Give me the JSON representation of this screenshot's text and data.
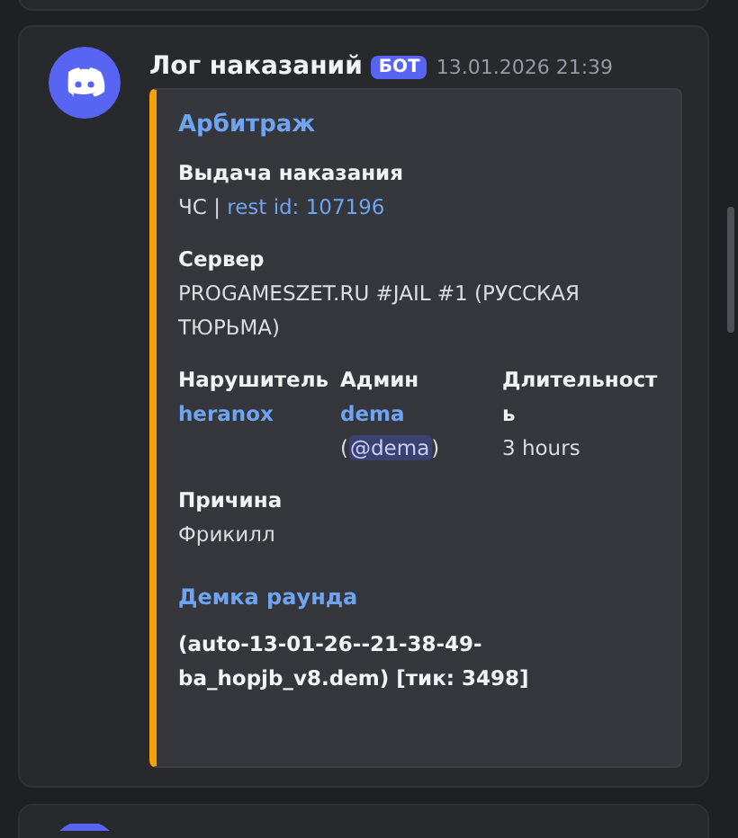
{
  "author": {
    "name": "Лог наказаний",
    "badge": "БОТ",
    "timestamp": "13.01.2026 21:39"
  },
  "embed": {
    "title": "Арбитраж",
    "fields": [
      {
        "name": "Выдача наказания",
        "inline": false,
        "lines": [
          [
            {
              "text": "ЧС | ",
              "kind": "plain"
            },
            {
              "text": "rest id: 107196",
              "kind": "link"
            }
          ]
        ]
      },
      {
        "name": "Сервер",
        "inline": false,
        "lines": [
          [
            {
              "text": "PROGAMESZET.RU #JAIL #1 (РУССКАЯ ТЮРЬМА)",
              "kind": "plain"
            }
          ]
        ]
      },
      {
        "name": "Нарушитель",
        "inline": true,
        "lines": [
          [
            {
              "text": "heranox",
              "kind": "strong-link"
            }
          ]
        ]
      },
      {
        "name": "Админ",
        "inline": true,
        "lines": [
          [
            {
              "text": "dema",
              "kind": "strong-link"
            }
          ],
          [
            {
              "text": "(",
              "kind": "plain"
            },
            {
              "text": "@dema",
              "kind": "mention"
            },
            {
              "text": ")",
              "kind": "plain"
            }
          ]
        ]
      },
      {
        "name": "Длительность",
        "inline": true,
        "lines": [
          [
            {
              "text": "3 hours",
              "kind": "plain"
            }
          ]
        ]
      },
      {
        "name": "Причина",
        "inline": false,
        "lines": [
          [
            {
              "text": "Фрикилл",
              "kind": "plain"
            }
          ]
        ]
      }
    ],
    "demo": {
      "title": "Демка раунда",
      "text": "(auto-13-01-26--21-38-49-ba_hopjb_v8.dem) [тик: 3498]"
    }
  }
}
